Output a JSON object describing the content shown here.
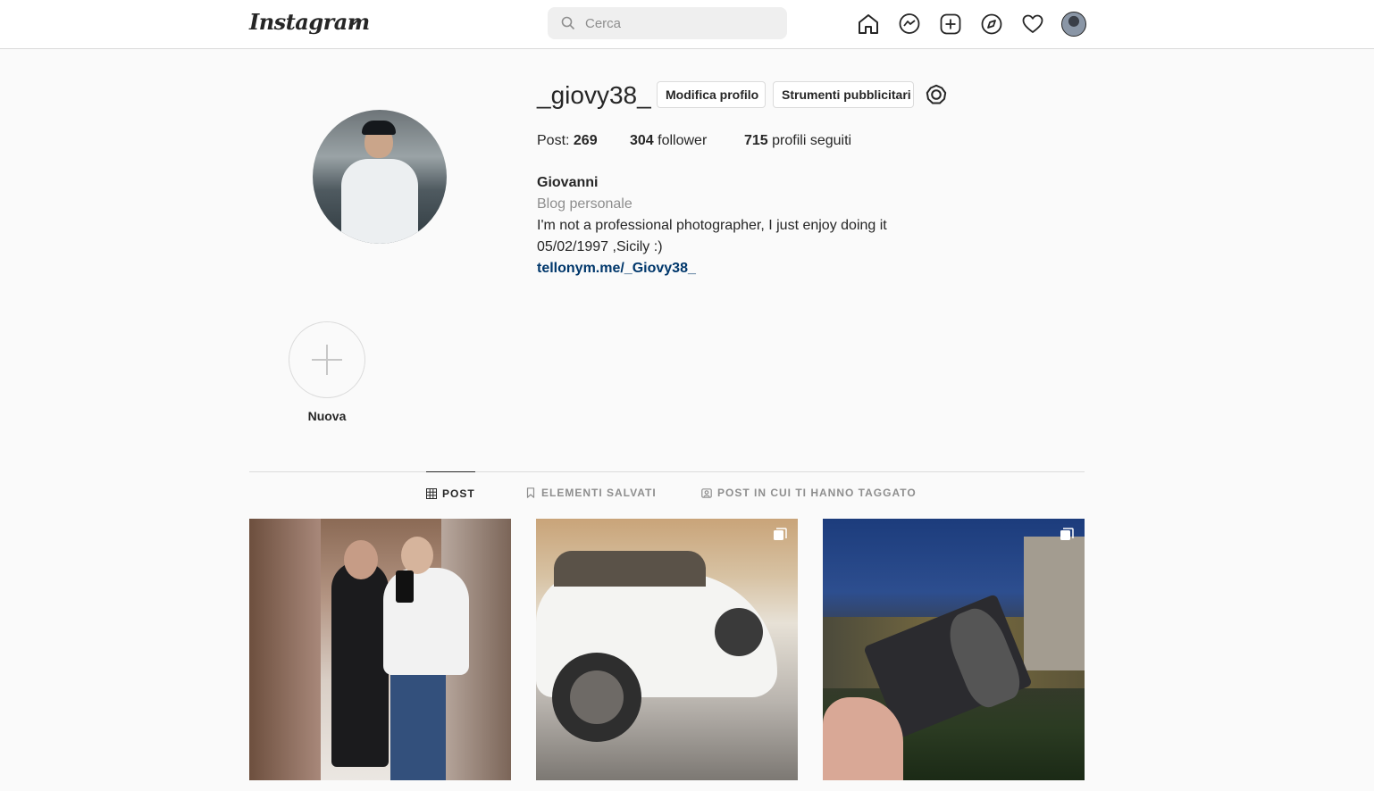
{
  "app": {
    "logo_text": "Instagram",
    "chevron_icon": "chevron-down-icon"
  },
  "search": {
    "placeholder": "Cerca",
    "icon": "search-icon"
  },
  "nav_icons": [
    "home-icon",
    "messenger-icon",
    "new-post-icon",
    "explore-icon",
    "activity-heart-icon",
    "profile-avatar"
  ],
  "profile": {
    "username": "_giovy38_",
    "edit_button": "Modifica profilo",
    "tools_button": "Strumenti pubblicitari",
    "settings_icon": "gear-icon",
    "stats": {
      "posts_label": "Post: ",
      "posts_count": "269",
      "followers_count": "304",
      "followers_label": " follower",
      "following_count": "715",
      "following_label": " profili seguiti"
    },
    "bio": {
      "name": "Giovanni",
      "category": "Blog personale",
      "line1": "I'm not a professional photographer, I just enjoy doing it",
      "line2": "05/02/1997 ,Sicily :)",
      "link": "tellonym.me/_Giovy38_"
    }
  },
  "highlights": [
    {
      "label": "Nuova",
      "icon": "plus-icon"
    }
  ],
  "tabs": [
    {
      "label": "POST",
      "icon": "grid-icon",
      "active": true
    },
    {
      "label": "ELEMENTI SALVATI",
      "icon": "bookmark-icon",
      "active": false
    },
    {
      "label": "POST IN CUI TI HANNO TAGGATO",
      "icon": "tagged-icon",
      "active": false
    }
  ],
  "posts": [
    {
      "subject": "mirror selfie couple",
      "multiple": false
    },
    {
      "subject": "white convertible car",
      "multiple": true
    },
    {
      "subject": "museum card at night",
      "multiple": true
    }
  ],
  "colors": {
    "text": "#262626",
    "muted": "#8e8e8e",
    "border": "#dbdbdb",
    "link": "#00376b",
    "background": "#fafafa"
  }
}
